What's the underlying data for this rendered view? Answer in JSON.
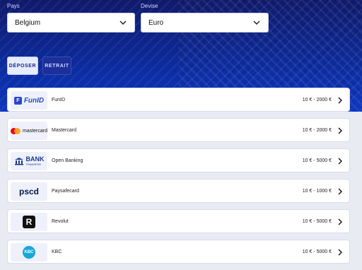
{
  "filters": {
    "country": {
      "label": "Pays",
      "value": "Belgium"
    },
    "currency": {
      "label": "Devise",
      "value": "Euro"
    }
  },
  "tabs": [
    {
      "label": "DÉPOSER",
      "active": true
    },
    {
      "label": "RETRAIT",
      "active": false
    }
  ],
  "methods": [
    {
      "name": "FunID",
      "range": "10 € - 2000 €",
      "logo_text": "FunID",
      "logo_badge": "F"
    },
    {
      "name": "Mastercard",
      "range": "10 € - 2000 €",
      "logo_text": "mastercard"
    },
    {
      "name": "Open Banking",
      "range": "10 € - 5000 €",
      "logo_text_1": "BANK",
      "logo_text_2": "TRANSFER"
    },
    {
      "name": "Paysafecard",
      "range": "10 € - 1000 €",
      "logo_text": "pscd"
    },
    {
      "name": "Revolut",
      "range": "10 € - 5000 €",
      "logo_text": "R"
    },
    {
      "name": "KBC",
      "range": "10 € - 5000 €",
      "logo_text": "KBC"
    }
  ],
  "colors": {
    "header_bg": "#0c2a9a",
    "accent": "#1a2a84"
  }
}
